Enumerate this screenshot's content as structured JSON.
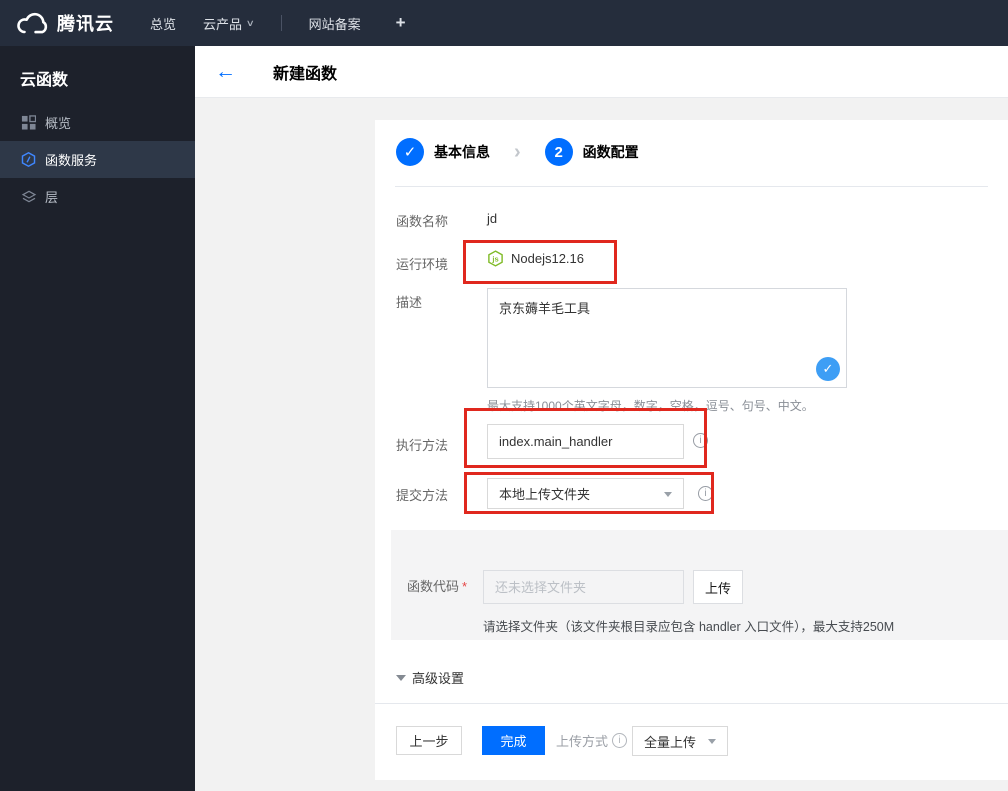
{
  "topbar": {
    "brand": "腾讯云",
    "nav_overview": "总览",
    "nav_products": "云产品",
    "nav_products_caret": "∨",
    "nav_icp": "网站备案",
    "nav_plus": "+"
  },
  "sidebar": {
    "title": "云函数",
    "items": [
      {
        "label": "概览",
        "icon": "grid-icon",
        "active": false
      },
      {
        "label": "函数服务",
        "icon": "function-hexagon-icon",
        "active": true
      },
      {
        "label": "层",
        "icon": "layers-icon",
        "active": false
      }
    ]
  },
  "header": {
    "back_glyph": "←",
    "title": "新建函数"
  },
  "steps": {
    "step1": {
      "glyph": "✓",
      "label": "基本信息"
    },
    "separator": "›",
    "step2": {
      "num": "2",
      "label": "函数配置"
    }
  },
  "form": {
    "name": {
      "label": "函数名称",
      "value": "jd"
    },
    "runtime": {
      "label": "运行环境",
      "value": "Nodejs12.16",
      "icon": "nodejs-hexagon-icon",
      "icon_text": "js"
    },
    "description": {
      "label": "描述",
      "value": "京东薅羊毛工具",
      "valid_glyph": "✓",
      "hint": "最大支持1000个英文字母，数字，空格，逗号、句号、中文。"
    },
    "handler": {
      "label": "执行方法",
      "value": "index.main_handler",
      "info_glyph": "i"
    },
    "submit_method": {
      "label": "提交方法",
      "value": "本地上传文件夹",
      "info_glyph": "i"
    },
    "code": {
      "label": "函数代码",
      "required_mark": "*",
      "placeholder": "还未选择文件夹",
      "upload_button": "上传",
      "hint": "请选择文件夹（该文件夹根目录应包含 handler 入口文件），最大支持250M"
    },
    "advanced_label": "高级设置"
  },
  "footer": {
    "prev_button": "上一步",
    "finish_button": "完成",
    "upload_mode_label": "上传方式",
    "upload_mode_info_glyph": "i",
    "upload_mode_value": "全量上传"
  },
  "colors": {
    "topbar_bg": "#252d3c",
    "sidebar_bg": "#1d212b",
    "sidebar_active_bg": "#2e3848",
    "primary_blue": "#006eff",
    "valid_badge_blue": "#3d9ef5",
    "annotation_red": "#e0281e",
    "nodejs_green": "#80bb28",
    "page_bg": "#f2f2f2",
    "code_section_bg": "#f4f4f5"
  }
}
